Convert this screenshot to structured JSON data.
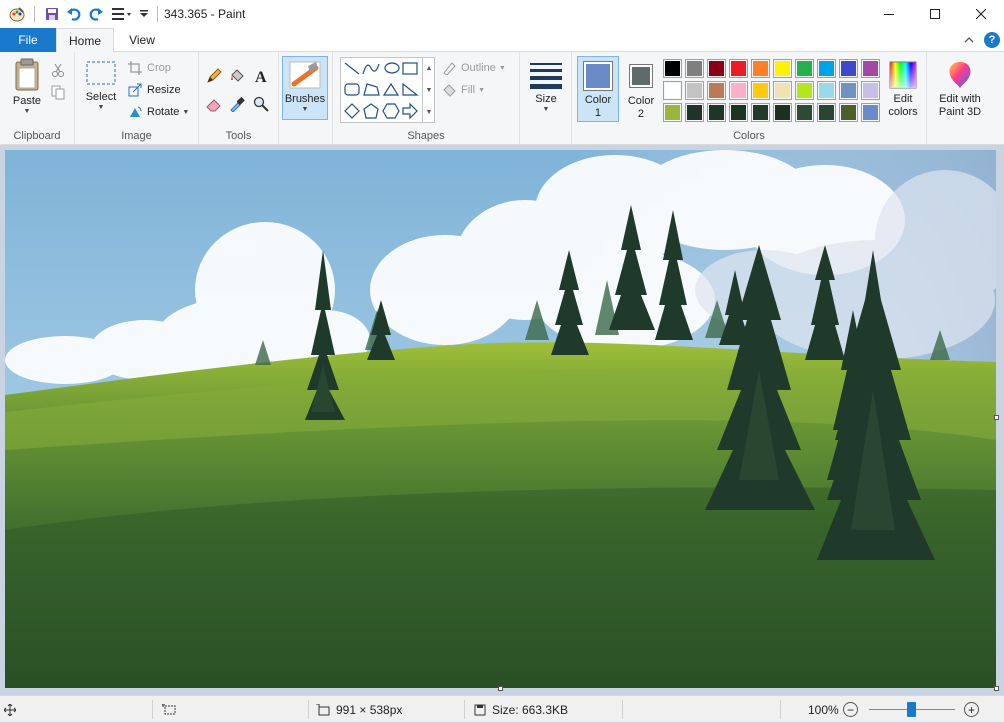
{
  "window": {
    "title": "343.365 - Paint"
  },
  "tabs": {
    "file": "File",
    "home": "Home",
    "view": "View"
  },
  "ribbon": {
    "clipboard": {
      "label": "Clipboard",
      "paste": "Paste"
    },
    "image": {
      "label": "Image",
      "select": "Select",
      "crop": "Crop",
      "resize": "Resize",
      "rotate": "Rotate"
    },
    "tools": {
      "label": "Tools"
    },
    "brushes": {
      "label": "Brushes"
    },
    "shapes": {
      "label": "Shapes",
      "outline": "Outline",
      "fill": "Fill"
    },
    "size": {
      "label": "Size"
    },
    "colors": {
      "label": "Colors",
      "color1": "Color 1",
      "color1_line1": "Color",
      "color1_line2": "1",
      "color2_line1": "Color",
      "color2_line2": "2",
      "color1_value": "#6a8ac8",
      "color2_value": "#5f6b6b",
      "edit_line1": "Edit",
      "edit_line2": "colors",
      "palette_row1": [
        "#000000",
        "#7f7f7f",
        "#880015",
        "#ed1c24",
        "#ff7f27",
        "#fff200",
        "#22b14c",
        "#00a2e8",
        "#3f48cc",
        "#a349a4"
      ],
      "palette_row2": [
        "#ffffff",
        "#c3c3c3",
        "#b97a57",
        "#ffaec9",
        "#ffc90e",
        "#efe4b0",
        "#b5e61d",
        "#99d9ea",
        "#7092be",
        "#c8bfe7"
      ],
      "palette_row3": [
        "#9bb53a",
        "#1f3326",
        "#20352a",
        "#1d3324",
        "#223a2a",
        "#1c3022",
        "#2c4a36",
        "#2a4532",
        "#4e5e2a",
        "#6a8ac8"
      ]
    },
    "paint3d": {
      "line1": "Edit with",
      "line2": "Paint 3D"
    }
  },
  "status": {
    "dimensions": "991 × 538px",
    "size": "Size: 663.3KB",
    "zoom": "100%",
    "zoom_level_percent": 100
  }
}
